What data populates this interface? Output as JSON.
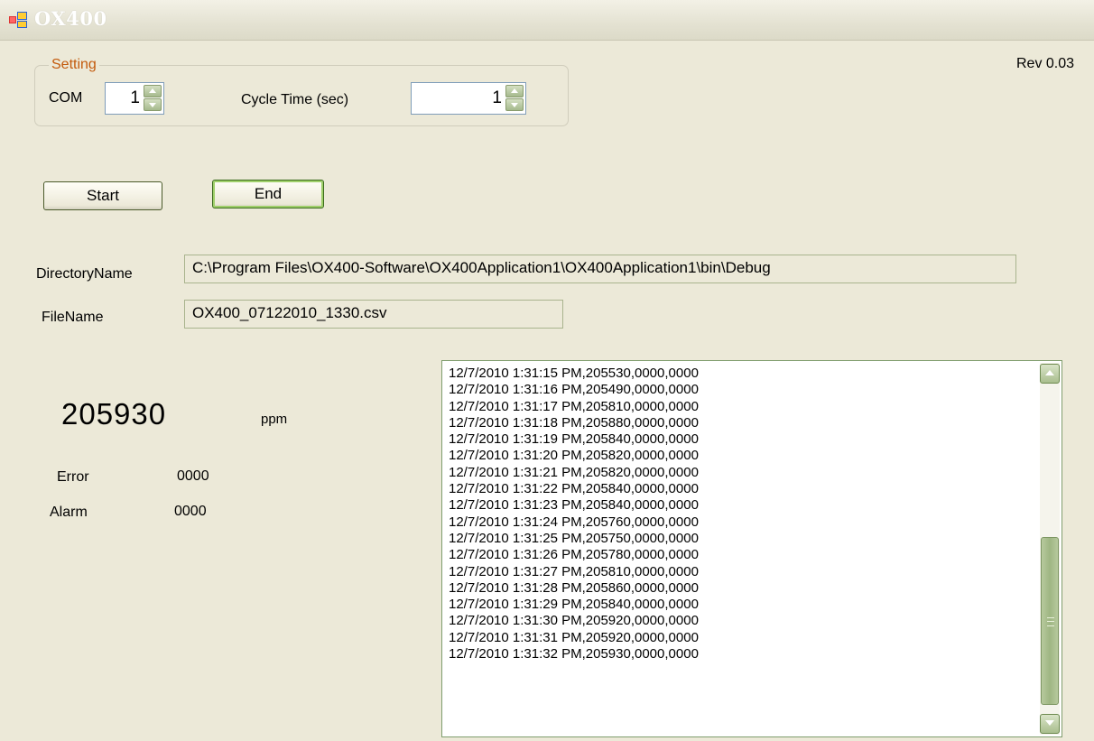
{
  "window": {
    "title": "OX400",
    "rev": "Rev 0.03"
  },
  "setting": {
    "legend": "Setting",
    "com_label": "COM",
    "com_value": "1",
    "cycle_label": "Cycle Time (sec)",
    "cycle_value": "1"
  },
  "buttons": {
    "start": "Start",
    "end": "End"
  },
  "paths": {
    "directory_label": "DirectoryName",
    "directory_value": "C:\\Program Files\\OX400-Software\\OX400Application1\\OX400Application1\\bin\\Debug",
    "file_label": "FileName",
    "file_value": "OX400_07122010_1330.csv"
  },
  "reading": {
    "value": "205930",
    "unit": "ppm",
    "error_label": "Error",
    "error_value": "0000",
    "alarm_label": "Alarm",
    "alarm_value": "0000"
  },
  "log": [
    "12/7/2010 1:31:15 PM,205530,0000,0000",
    "12/7/2010 1:31:16 PM,205490,0000,0000",
    "12/7/2010 1:31:17 PM,205810,0000,0000",
    "12/7/2010 1:31:18 PM,205880,0000,0000",
    "12/7/2010 1:31:19 PM,205840,0000,0000",
    "12/7/2010 1:31:20 PM,205820,0000,0000",
    "12/7/2010 1:31:21 PM,205820,0000,0000",
    "12/7/2010 1:31:22 PM,205840,0000,0000",
    "12/7/2010 1:31:23 PM,205840,0000,0000",
    "12/7/2010 1:31:24 PM,205760,0000,0000",
    "12/7/2010 1:31:25 PM,205750,0000,0000",
    "12/7/2010 1:31:26 PM,205780,0000,0000",
    "12/7/2010 1:31:27 PM,205810,0000,0000",
    "12/7/2010 1:31:28 PM,205860,0000,0000",
    "12/7/2010 1:31:29 PM,205840,0000,0000",
    "12/7/2010 1:31:30 PM,205920,0000,0000",
    "12/7/2010 1:31:31 PM,205920,0000,0000",
    "12/7/2010 1:31:32 PM,205930,0000,0000"
  ],
  "icons": {
    "app": "app-window-icon",
    "spin_up": "arrow-up-icon",
    "spin_down": "arrow-down-icon",
    "scroll_up": "scroll-up-icon",
    "scroll_down": "scroll-down-icon"
  },
  "colors": {
    "window_bg": "#ece9d8",
    "legend_text": "#c35a0c",
    "title_text": "#ffffff",
    "scroll_green": "#a9be8e"
  }
}
